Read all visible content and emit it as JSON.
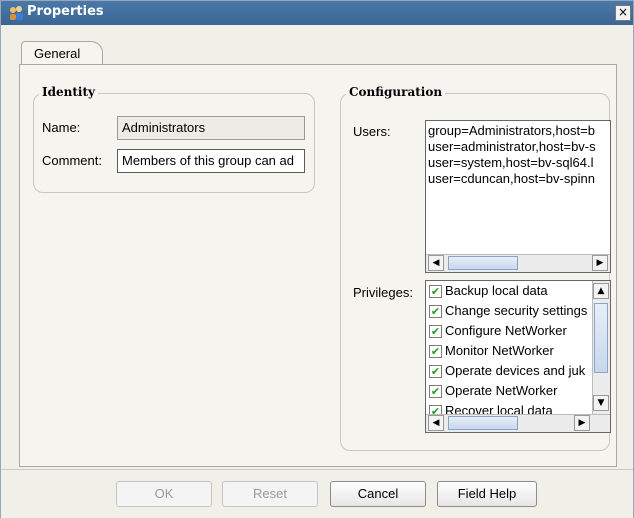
{
  "window": {
    "title": "Properties",
    "close_label": "×"
  },
  "tabs": [
    {
      "label": "General"
    }
  ],
  "identity": {
    "title": "Identity",
    "name_label": "Name:",
    "name_value": "Administrators",
    "comment_label": "Comment:",
    "comment_value": "Members of this group can ad"
  },
  "configuration": {
    "title": "Configuration",
    "users_label": "Users:",
    "users": [
      "group=Administrators,host=b",
      "user=administrator,host=bv-s",
      "user=system,host=bv-sql64.l",
      "user=cduncan,host=bv-spinn"
    ],
    "privileges_label": "Privileges:",
    "privileges": [
      {
        "label": "Backup local data",
        "checked": true
      },
      {
        "label": "Change security settings",
        "checked": true
      },
      {
        "label": "Configure NetWorker",
        "checked": true
      },
      {
        "label": "Monitor NetWorker",
        "checked": true
      },
      {
        "label": "Operate devices and juk",
        "checked": true
      },
      {
        "label": "Operate NetWorker",
        "checked": true
      },
      {
        "label": "Recover local data",
        "checked": true
      }
    ]
  },
  "buttons": {
    "ok": "OK",
    "reset": "Reset",
    "cancel": "Cancel",
    "help": "Field Help"
  },
  "glyphs": {
    "left": "◀",
    "right": "▶",
    "up": "▲",
    "down": "▼",
    "check": "✔"
  }
}
